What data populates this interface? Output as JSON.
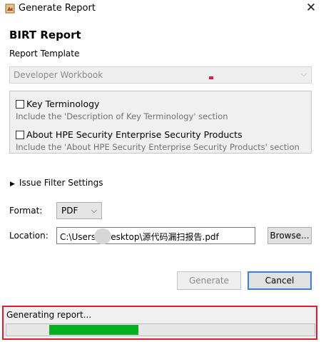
{
  "window": {
    "title": "Generate Report",
    "close_glyph": "✕",
    "icon": "birt-app-icon"
  },
  "dialog": {
    "heading": "BIRT Report",
    "template_label": "Report Template",
    "template_value": "Developer Workbook",
    "chevron_glyph": "⌵"
  },
  "options": [
    {
      "label": "Key Terminology",
      "checked": false,
      "description": "Include the 'Description of Key Terminology' section"
    },
    {
      "label": "About HPE Security Enterprise Security Products",
      "checked": false,
      "description": "Include the 'About HPE Security Enterprise Security Products' section"
    }
  ],
  "filter": {
    "label": "Issue Filter Settings",
    "expanded": false,
    "toggle_glyph": "▶"
  },
  "format": {
    "label": "Format:",
    "value": "PDF",
    "chevron_glyph": "⌵"
  },
  "location": {
    "label": "Location:",
    "value": "C:\\Users\\       \\Desktop\\源代码漏扫报告.pdf",
    "browse_label": "Browse..."
  },
  "buttons": {
    "generate": "Generate",
    "cancel": "Cancel"
  },
  "status": {
    "text": "Generating report...",
    "progress_range": [
      0.14,
      0.43
    ]
  },
  "colors": {
    "progress": "#06b025",
    "highlight_border": "#e21c2c",
    "focus_border": "#3c7fd9"
  }
}
